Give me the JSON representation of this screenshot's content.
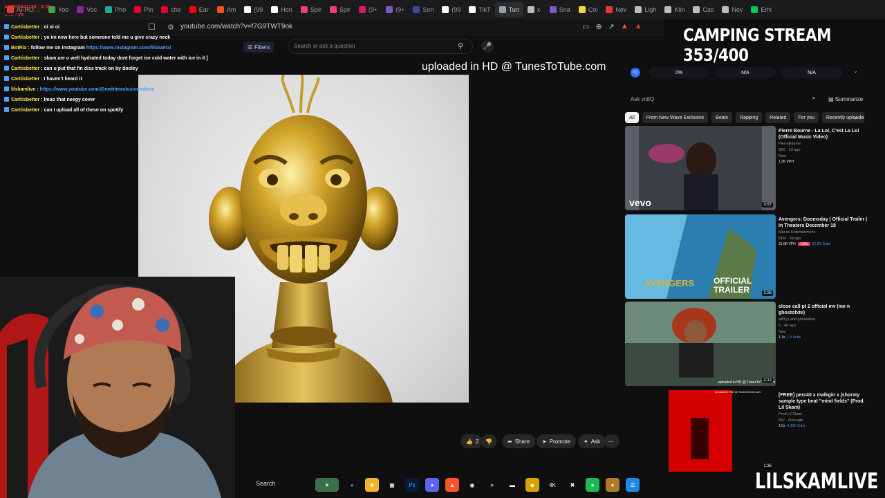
{
  "browser": {
    "tabs": [
      {
        "label": "AFRO…",
        "color": "#e53935"
      },
      {
        "label": "Yoo",
        "color": "#43a047"
      },
      {
        "label": "Voc",
        "color": "#8e24aa"
      },
      {
        "label": "Pho",
        "color": "#26a69a"
      },
      {
        "label": "Pin",
        "color": "#e60023"
      },
      {
        "label": "che",
        "color": "#e60023"
      },
      {
        "label": "Ear",
        "color": "#ff0000"
      },
      {
        "label": "Am",
        "color": "#f4511e"
      },
      {
        "label": "(99",
        "color": "#ffffff"
      },
      {
        "label": "Hon",
        "color": "#ffffff"
      },
      {
        "label": "Spir",
        "color": "#ec407a"
      },
      {
        "label": "Spir",
        "color": "#ec407a"
      },
      {
        "label": "(9+",
        "color": "#d81b60"
      },
      {
        "label": "(9+",
        "color": "#7e57c2"
      },
      {
        "label": "Son",
        "color": "#3949ab"
      },
      {
        "label": "(99",
        "color": "#ffffff"
      },
      {
        "label": "TikT",
        "color": "#ffffff"
      },
      {
        "label": "Tun",
        "color": "#90a4ae"
      },
      {
        "label": "x",
        "color": "#bdbdbd"
      },
      {
        "label": "Sna",
        "color": "#7e57c2"
      },
      {
        "label": "Coi",
        "color": "#fdd835"
      },
      {
        "label": "Nev",
        "color": "#e53935"
      },
      {
        "label": "Ligh",
        "color": "#bdbdbd"
      },
      {
        "label": "Klin",
        "color": "#bdbdbd"
      },
      {
        "label": "Cas",
        "color": "#bdbdbd"
      },
      {
        "label": "Nev",
        "color": "#bdbdbd"
      },
      {
        "label": "Emi",
        "color": "#00c853"
      }
    ],
    "url": "youtube.com/watch?v=f7G9TWT9ok"
  },
  "youtube": {
    "filters_label": "Filters",
    "search_placeholder": "Search or ask a question"
  },
  "chat": {
    "timer": "AFRO0641138 : 0:35",
    "header_line": "…… : yo",
    "lines": [
      {
        "user": "Cartiisbetter",
        "text": " : oi oi oi",
        "type": "msg"
      },
      {
        "user": "Cartiisbetter",
        "text": " : yo im new here but someone told me u give crazy neck",
        "type": "msg"
      },
      {
        "user": "BotRix",
        "text": " : follow me on instagram ",
        "link": "https://www.instagram.com/lilskamx/",
        "type": "link"
      },
      {
        "user": "Cartiisbetter",
        "text": " : skam are u well hydrated today dont forget ice cold water with ice in it ]",
        "type": "msg"
      },
      {
        "user": "Cartiisbetter",
        "text": " : can u put that fin diss track on by dooley",
        "type": "msg"
      },
      {
        "user": "Cartiisbetter",
        "text": " : I haven't heard it",
        "type": "msg"
      },
      {
        "user": "lilskamlive",
        "text": " : ",
        "link": "https://www.youtube.com/@nwhhexclusivevideos",
        "type": "link"
      },
      {
        "user": "Cartiisbetter",
        "text": " : lmao that neegy cover",
        "type": "msg"
      },
      {
        "user": "Cartiisbetter",
        "text": " : can I upload all of these on spotify",
        "type": "msg"
      }
    ]
  },
  "video": {
    "watermark": "uploaded in HD @ TunesToTube.com",
    "like_count": "2",
    "share_label": "Share",
    "promote_label": "Promote",
    "ask_label": "Ask"
  },
  "stream": {
    "title": "CAMPING STREAM 353/400",
    "streamer": "LILSKAMLIVE"
  },
  "vidiq": {
    "logo": "iQ",
    "stats": [
      "0%",
      "N/A",
      "N/A"
    ],
    "ask_placeholder": "Ask vidIQ",
    "summarize_label": "Summarize"
  },
  "chips": [
    "All",
    "From New Wave Exclusive",
    "Beats",
    "Rapping",
    "Related",
    "For you",
    "Recently uploaded"
  ],
  "recommendations": [
    {
      "title": "Pierre Bourne - La Loi, C'est La Loi (Official Music Video)",
      "channel": "PierreBourne",
      "meta": "92K · 2d ago",
      "badge": "New",
      "stat": "1.2K VPH",
      "duration": "3:57",
      "thumb_label": "vevo"
    },
    {
      "title": "Avengers: Doomsday | Official Trailer | In Theaters December 18",
      "channel": "Marvel Entertainment",
      "meta": "61M · 2d ago",
      "stat": "31.6K VPH",
      "stat2": "+100x",
      "stat3": "23.2M Subs",
      "duration": "2:26",
      "thumb_label": "OFFICIAL TRAILER"
    },
    {
      "title": "close call pt 2 official mv (me n ghostofxte)",
      "channel": "wif3yy and ghostofxte",
      "meta": "6 · 4d ago",
      "badge": "New",
      "stat": "1.1x",
      "stat3": "1.5 Subs",
      "duration": "2:12",
      "thumb_label": "uploaded in HD @ TunesToTube.com"
    },
    {
      "title": "[FREE] perc40 x maikgin x jshorxty sample type beat \"mind fields\" (Prod. Lil Skam)",
      "channel": "Prod Lil Skam",
      "meta": "397 · 6mo ago",
      "stat": "1.0x",
      "stat3": "3.03K Subs",
      "duration": "1:36",
      "thumb_label": "uploaded in HD @ TunesToTube.com"
    }
  ],
  "taskbar": {
    "search_label": "Search"
  }
}
